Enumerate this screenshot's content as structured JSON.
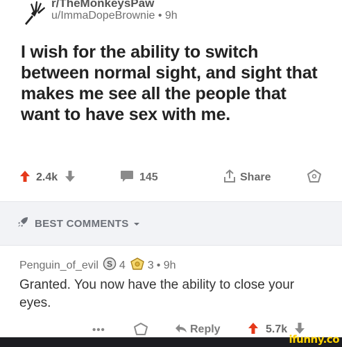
{
  "post": {
    "subreddit": "r/TheMonkeysPaw",
    "author_line": "u/ImmaDopeBrownie • 9h",
    "title": "I wish for the ability to switch between normal sight, and sight that makes me see all the people that want to have sex with me.",
    "upvotes": "2.4k",
    "comments_count": "145",
    "share_label": "Share"
  },
  "sort": {
    "label": "BEST COMMENTS"
  },
  "comment": {
    "username": "Penguin_of_evil",
    "silver_count": "4",
    "gold_count": "3",
    "time": "• 9h",
    "body": "Granted. You now have the ability to close your eyes.",
    "more_label": "•••",
    "reply_label": "Reply",
    "votes": "5.7k"
  },
  "watermark": "ifunny.co",
  "colors": {
    "upvote": "#e5391a",
    "muted": "#8a8a8a",
    "section_bg": "#f2f3f6",
    "watermark": "#ffd200"
  }
}
